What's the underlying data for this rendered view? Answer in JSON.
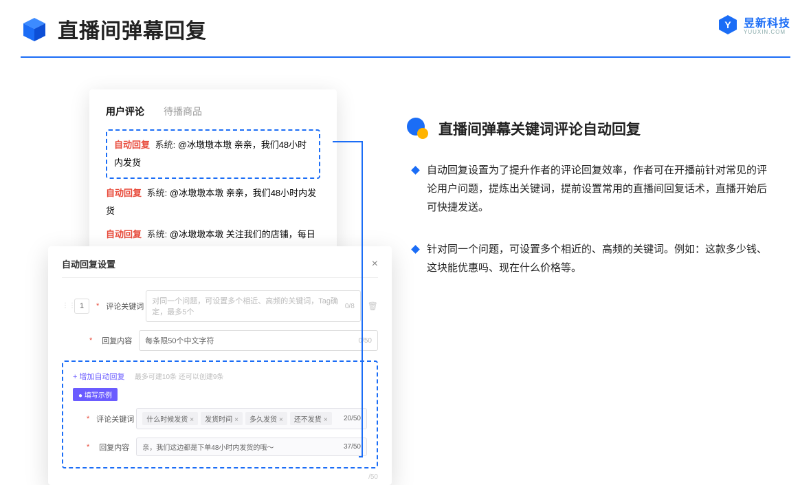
{
  "header": {
    "title": "直播间弹幕回复",
    "logo_text": "昱新科技",
    "logo_sub": "YUUXIN.COM"
  },
  "comments_panel": {
    "tab_active": "用户评论",
    "tab_inactive": "待播商品",
    "reply_tag": "自动回复",
    "sys_label": "系统:",
    "highlight_text": "@冰墩墩本墩 亲亲，我们48小时内发货",
    "item2_text": "@冰墩墩本墩 亲亲，我们48小时内发货",
    "item3_text": "@冰墩墩本墩 关注我们的店铺，每日都有热门推荐呦～"
  },
  "settings_panel": {
    "title": "自动回复设置",
    "close": "×",
    "index": "1",
    "label_keyword": "评论关键词",
    "label_content": "回复内容",
    "placeholder_keyword": "对同一个问题，可设置多个相近、高频的关键词，Tag确定，最多5个",
    "counter_keyword": "0/8",
    "placeholder_content": "每条限50个中文字符",
    "counter_content": "0/50",
    "add_link": "+ 增加自动回复",
    "hint": "最多可建10条 还可以创建9条",
    "example_badge": "● 填写示例",
    "example_label_keyword": "评论关键词",
    "example_label_content": "回复内容",
    "tags": [
      "什么时候发货",
      "发货时间",
      "多久发货",
      "还不发货"
    ],
    "tag_counter": "20/50",
    "example_content": "亲，我们这边都是下单48小时内发货的哦～",
    "example_content_counter": "37/50",
    "stray_counter": "/50"
  },
  "right": {
    "section_title": "直播间弹幕关键词评论自动回复",
    "bullet1": "自动回复设置为了提升作者的评论回复效率，作者可在开播前针对常见的评论用户问题，提炼出关键词，提前设置常用的直播间回复话术，直播开始后可快捷发送。",
    "bullet2": "针对同一个问题，可设置多个相近的、高频的关键词。例如：这款多少钱、这块能优惠吗、现在什么价格等。"
  }
}
